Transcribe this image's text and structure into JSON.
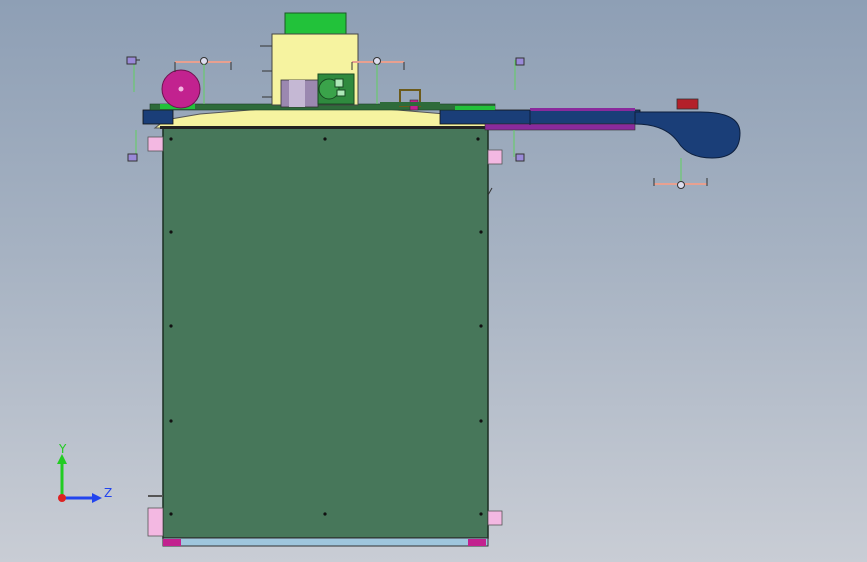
{
  "viewport": {
    "background_top": "#8e9fb5",
    "background_bottom": "#c9cdd5"
  },
  "model": {
    "cabinet_color": "#47775a",
    "cover_color": "#f6f3a0",
    "conveyor_color": "#1a3e78",
    "rail_color": "#8a2a9c",
    "pink_part_color": "#f3b8e2",
    "magenta_part_color": "#c2228f",
    "green_part_color": "#22c23a",
    "icons": [
      "sensor-bracket-icon",
      "pulley-icon",
      "motor-icon",
      "clamp-icon"
    ]
  },
  "triad": {
    "y_label": "Y",
    "z_label": "Z",
    "y_color": "#22cc22",
    "z_color": "#2244ee",
    "origin_color": "#dd2222"
  }
}
